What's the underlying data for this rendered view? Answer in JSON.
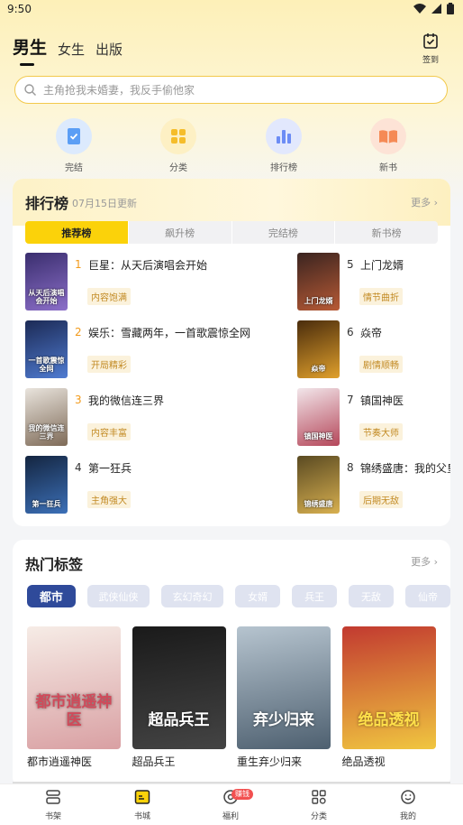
{
  "status": {
    "time": "9:50"
  },
  "header": {
    "tabs": [
      "男生",
      "女生",
      "出版"
    ],
    "signin_label": "签到"
  },
  "search": {
    "placeholder": "主角抢我未婚妻，我反手偷他家"
  },
  "quick": [
    {
      "label": "完结",
      "icon": "book-done-icon",
      "color": "#5b9ef5"
    },
    {
      "label": "分类",
      "icon": "grid-icon",
      "color": "#f5bd2b"
    },
    {
      "label": "排行榜",
      "icon": "bar-chart-icon",
      "color": "#6c8cf5"
    },
    {
      "label": "新书",
      "icon": "open-book-icon",
      "color": "#f58a55"
    }
  ],
  "rank": {
    "title": "排行榜",
    "date": "07月15日更新",
    "more": "更多",
    "tabs": [
      "推荐榜",
      "飙升榜",
      "完结榜",
      "新书榜"
    ],
    "books": [
      {
        "num": "1",
        "title": "巨星：从天后演唱会开始",
        "tag": "内容饱满",
        "cover": [
          "#3a2e6e",
          "#8c6fc9"
        ],
        "cover_text": "从天后演唱会开始"
      },
      {
        "num": "2",
        "title": "娱乐：雪藏两年，一首歌震惊全网",
        "tag": "开局精彩",
        "cover": [
          "#1c2a55",
          "#4f7bd1"
        ],
        "cover_text": "一首歌震惊全网"
      },
      {
        "num": "3",
        "title": "我的微信连三界",
        "tag": "内容丰富",
        "cover": [
          "#e9e4dd",
          "#7e6a57"
        ],
        "cover_text": "我的微信连三界"
      },
      {
        "num": "4",
        "title": "第一狂兵",
        "tag": "主角强大",
        "cover": [
          "#142540",
          "#3c70b8"
        ],
        "cover_text": "第一狂兵"
      },
      {
        "num": "5",
        "title": "上门龙婿",
        "tag": "情节曲折",
        "cover": [
          "#3a2420",
          "#b85a35"
        ],
        "cover_text": "上门龙婿"
      },
      {
        "num": "6",
        "title": "焱帝",
        "tag": "剧情顺畅",
        "cover": [
          "#4a2c0c",
          "#e0a02c"
        ],
        "cover_text": "焱帝"
      },
      {
        "num": "7",
        "title": "镇国神医",
        "tag": "节奏大师",
        "cover": [
          "#f2e6ea",
          "#b5475a"
        ],
        "cover_text": "镇国神医"
      },
      {
        "num": "8",
        "title": "锦绣盛唐：我的父皇",
        "tag": "后期无敌",
        "cover": [
          "#5a4a22",
          "#d8b050"
        ],
        "cover_text": "锦绣盛唐"
      }
    ]
  },
  "tags": {
    "title": "热门标签",
    "more": "更多",
    "chips": [
      "都市",
      "武侠仙侠",
      "玄幻奇幻",
      "女婿",
      "兵王",
      "无敌",
      "仙帝"
    ],
    "books": [
      {
        "title": "都市逍遥神医",
        "cover": [
          "#f6ece6",
          "#d9a0a3"
        ],
        "cover_text": "都市逍遥神医",
        "text_color": "#d04a5a"
      },
      {
        "title": "超品兵王",
        "cover": [
          "#1a1a1a",
          "#444444"
        ],
        "cover_text": "超品兵王",
        "text_color": "#ffffff"
      },
      {
        "title": "重生弃少归来",
        "cover": [
          "#b6c4cf",
          "#4e6070"
        ],
        "cover_text": "弃少归来",
        "text_color": "#ffffff"
      },
      {
        "title": "绝品透视",
        "cover": [
          "#c23a30",
          "#f0c640"
        ],
        "cover_text": "绝品透视",
        "text_color": "#ffe04a"
      }
    ]
  },
  "nav": [
    {
      "label": "书架",
      "icon": "bookshelf-icon"
    },
    {
      "label": "书城",
      "icon": "bookstore-icon"
    },
    {
      "label": "福利",
      "icon": "welfare-icon",
      "badge": "赚钱"
    },
    {
      "label": "分类",
      "icon": "category-icon"
    },
    {
      "label": "我的",
      "icon": "profile-icon"
    }
  ],
  "colors": {
    "accent": "#fbd20a",
    "tag_text": "#c28a23",
    "chip_active": "#2f4a9a"
  }
}
